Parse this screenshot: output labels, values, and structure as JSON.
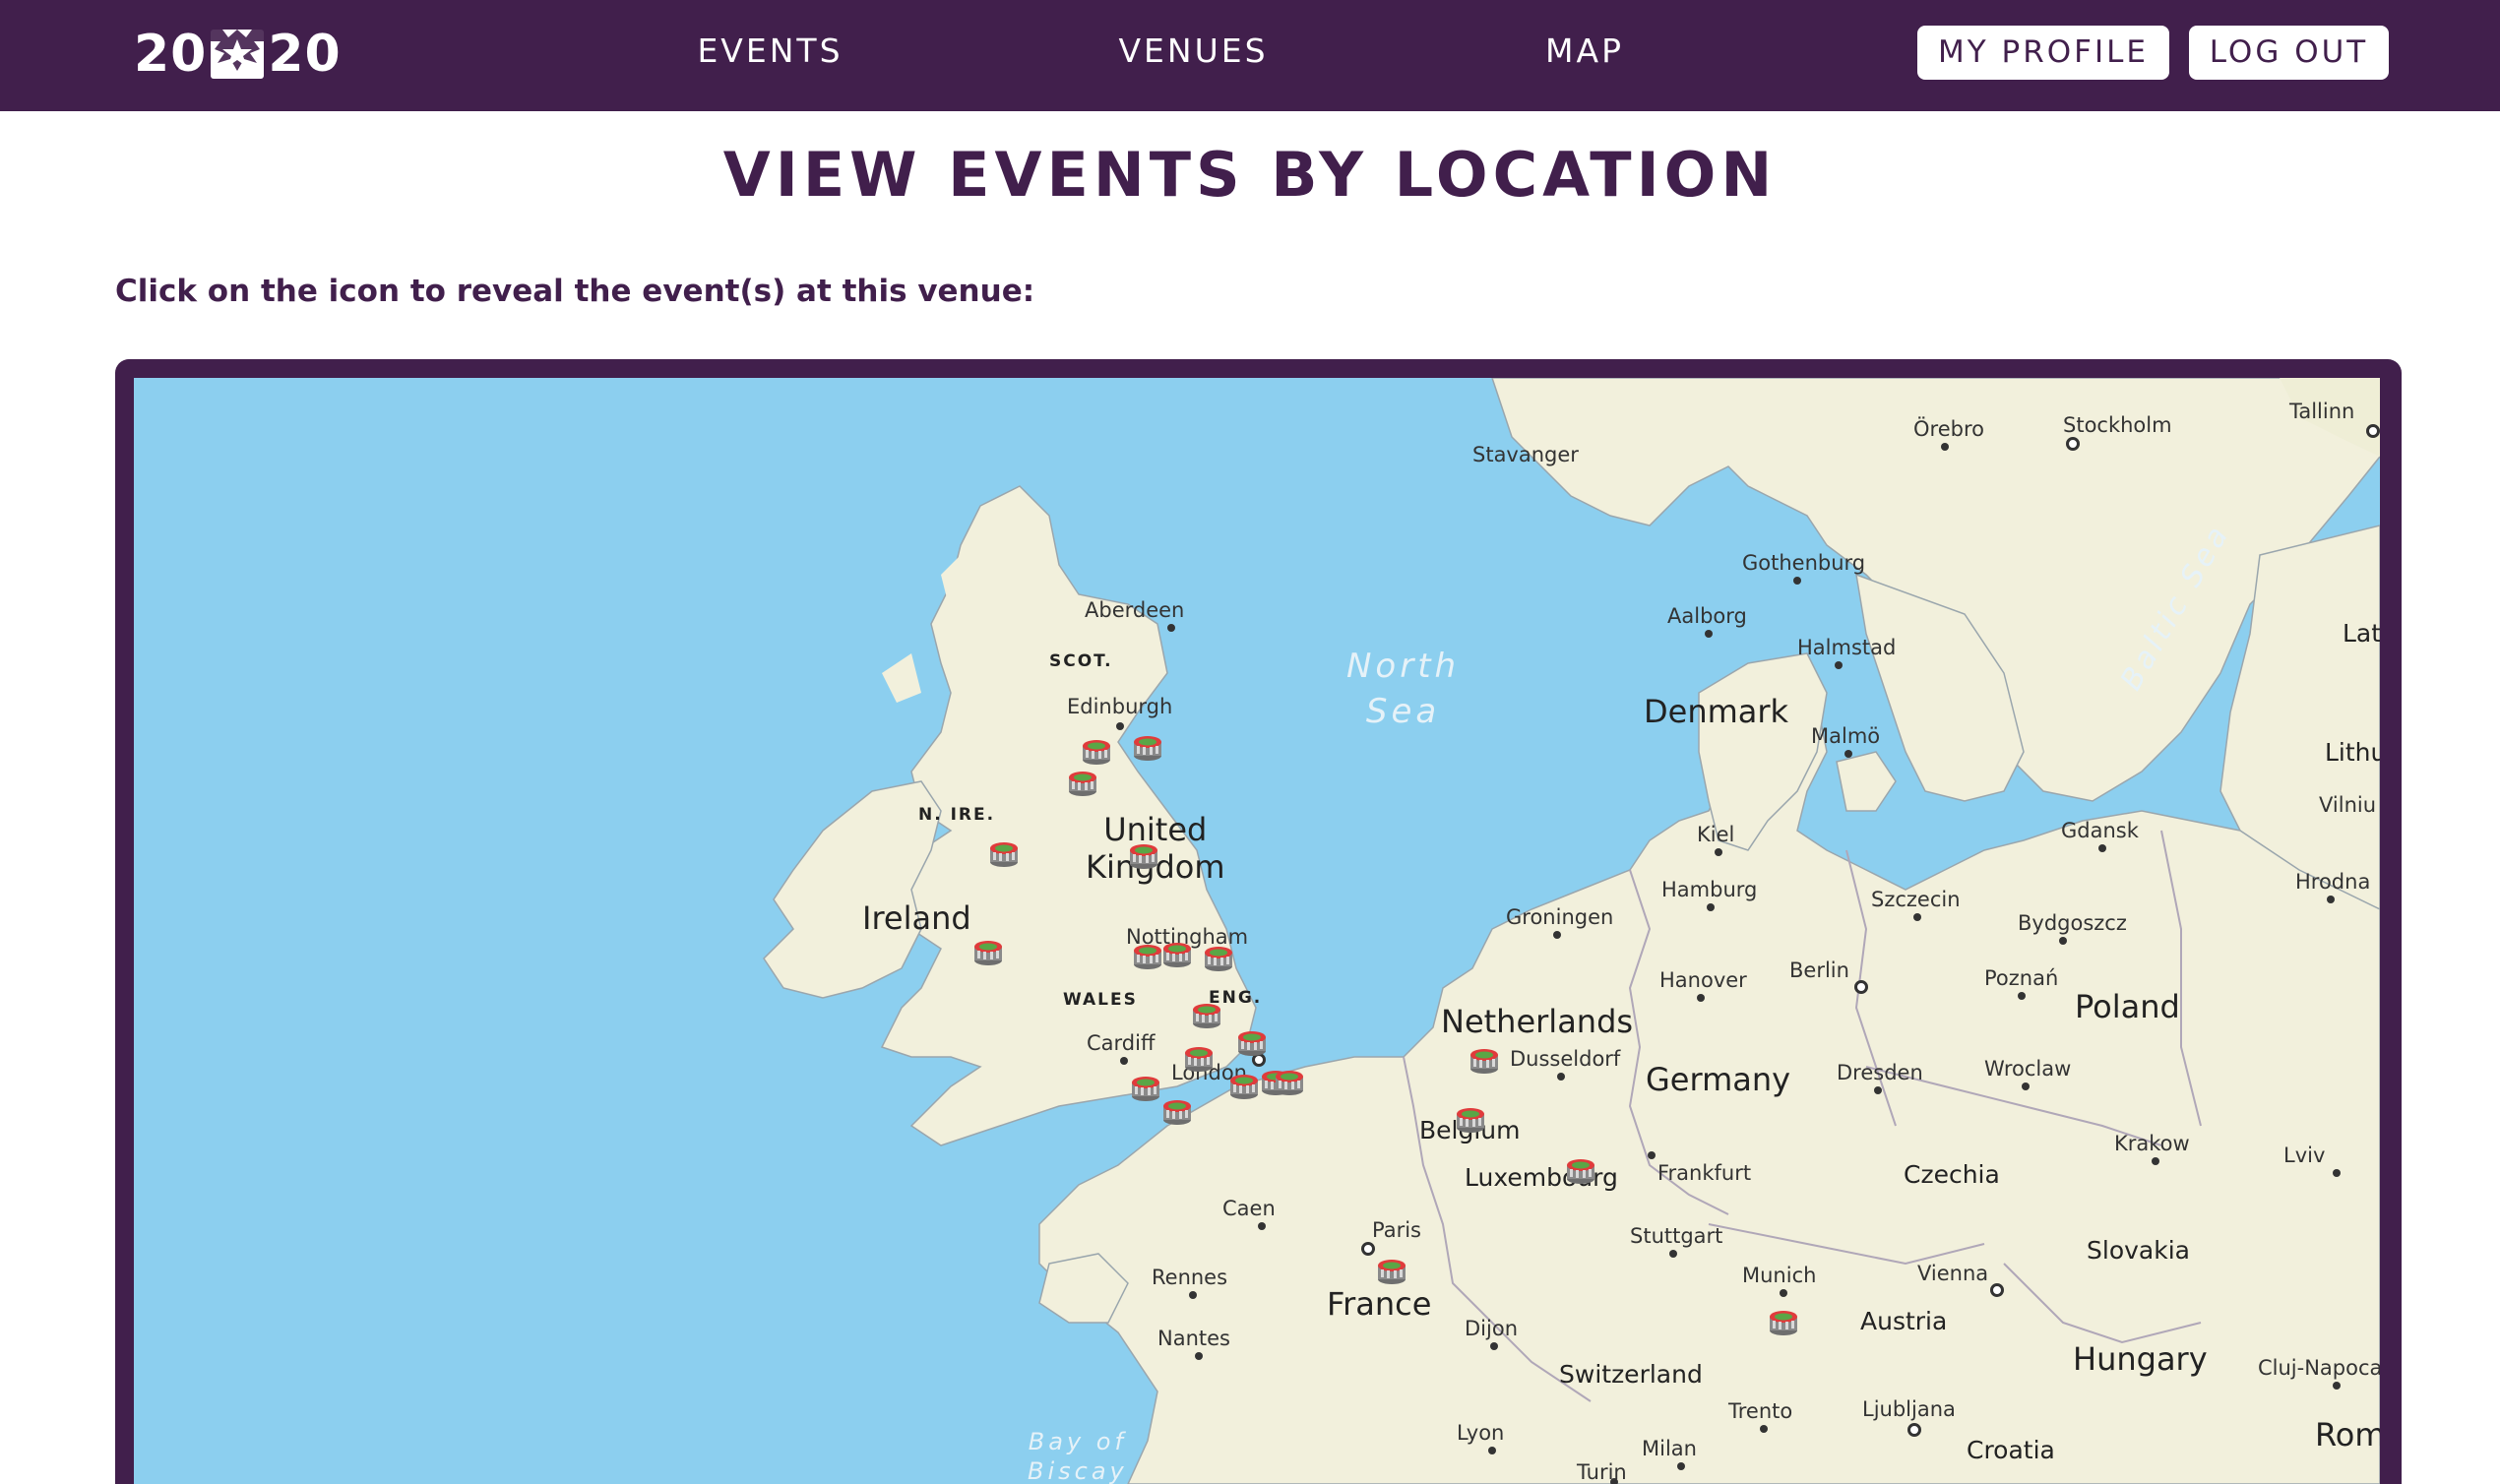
{
  "navbar": {
    "logo_left": "20",
    "logo_right": "20",
    "links": {
      "events": "EVENTS",
      "venues": "VENUES",
      "map": "MAP"
    },
    "buttons": {
      "profile": "MY PROFILE",
      "logout": "LOG OUT"
    }
  },
  "page": {
    "title": "VIEW EVENTS BY LOCATION",
    "instruction": "Click on the icon to reveal the event(s) at this venue:"
  },
  "map": {
    "seas": {
      "north_sea": "North\nSea",
      "baltic_sea": "Baltic Sea",
      "bay_of_biscay": "Bay of\nBiscay"
    },
    "countries": {
      "uk": "United\nKingdom",
      "ireland": "Ireland",
      "denmark": "Denmark",
      "netherlands": "Netherlands",
      "germany": "Germany",
      "belgium": "Belgium",
      "luxembourg": "Luxembourg",
      "france": "France",
      "poland": "Poland",
      "czechia": "Czechia",
      "slovakia": "Slovakia",
      "austria": "Austria",
      "hungary": "Hungary",
      "switzerland": "Switzerland",
      "croatia": "Croatia",
      "lithuania": "Lithuani",
      "latvia": "Lat",
      "romania": "Rom"
    },
    "regions": {
      "scot": "SCOT.",
      "n_ire": "N. IRE.",
      "wales": "WALES",
      "eng": "ENG."
    },
    "cities": {
      "orebro": "Örebro",
      "stockholm": "Stockholm",
      "tallinn": "Tallinn",
      "stavanger": "Stavanger",
      "gothenburg": "Gothenburg",
      "aberdeen": "Aberdeen",
      "aalborg": "Aalborg",
      "halmstad": "Halmstad",
      "edinburgh": "Edinburgh",
      "malmo": "Malmö",
      "kiel": "Kiel",
      "gdansk": "Gdansk",
      "vilnius": "Vilniu",
      "hamburg": "Hamburg",
      "szczecin": "Szczecin",
      "hrodna": "Hrodna",
      "groningen": "Groningen",
      "nottingham": "Nottingham",
      "bydgoszcz": "Bydgoszcz",
      "hanover": "Hanover",
      "berlin": "Berlin",
      "poznan": "Poznań",
      "cardiff": "Cardiff",
      "dusseldorf": "Dusseldorf",
      "london": "London",
      "dresden": "Dresden",
      "wroclaw": "Wroclaw",
      "krakow": "Krakow",
      "lviv": "Lviv",
      "frankfurt": "Frankfurt",
      "caen": "Caen",
      "paris": "Paris",
      "stuttgart": "Stuttgart",
      "rennes": "Rennes",
      "munich": "Munich",
      "vienna": "Vienna",
      "nantes": "Nantes",
      "dijon": "Dijon",
      "cluj": "Cluj-Napoca",
      "trento": "Trento",
      "ljubljana": "Ljubljana",
      "lyon": "Lyon",
      "milan": "Milan",
      "turin": "Turin"
    },
    "icon_name": "stadium-venue-icon",
    "marker_count": 22
  }
}
